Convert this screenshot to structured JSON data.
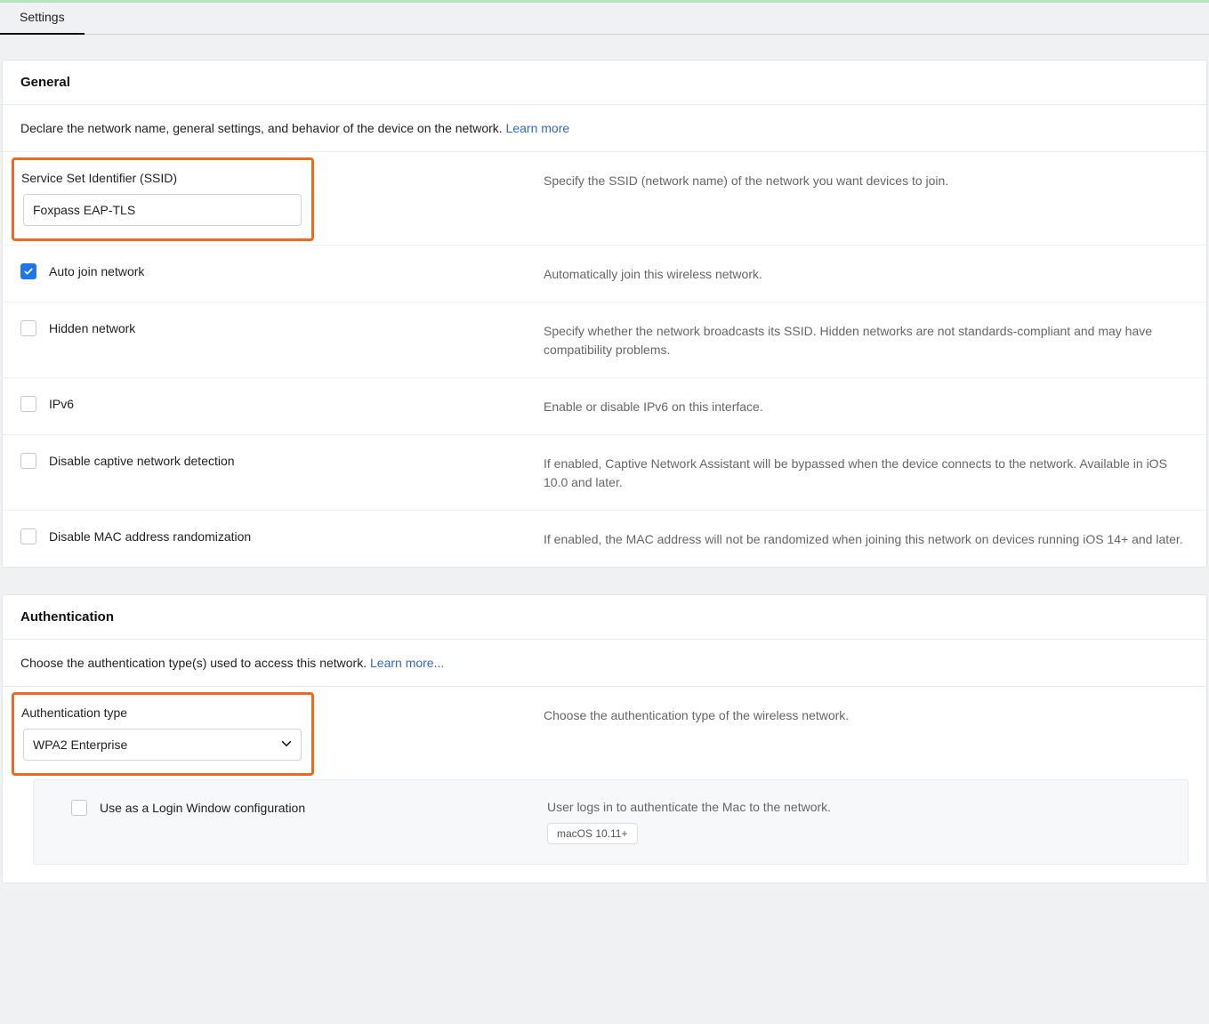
{
  "tab": {
    "label": "Settings"
  },
  "general": {
    "title": "General",
    "intro": "Declare the network name, general settings, and behavior of the device on the network. ",
    "learn": "Learn more",
    "ssid": {
      "label": "Service Set Identifier (SSID)",
      "value": "Foxpass EAP-TLS",
      "desc": "Specify the SSID (network name) of the network you want devices to join."
    },
    "auto_join": {
      "label": "Auto join network",
      "checked": true,
      "desc": "Automatically join this wireless network."
    },
    "hidden": {
      "label": "Hidden network",
      "checked": false,
      "desc": "Specify whether the network broadcasts its SSID. Hidden networks are not standards-compliant and may have compatibility problems."
    },
    "ipv6": {
      "label": "IPv6",
      "checked": false,
      "desc": "Enable or disable IPv6 on this interface."
    },
    "captive": {
      "label": "Disable captive network detection",
      "checked": false,
      "desc": "If enabled, Captive Network Assistant will be bypassed when the device connects to the network. Available in iOS 10.0 and later."
    },
    "mac_random": {
      "label": "Disable MAC address randomization",
      "checked": false,
      "desc": "If enabled, the MAC address will not be randomized when joining this network on devices running iOS 14+ and later."
    }
  },
  "auth": {
    "title": "Authentication",
    "intro": "Choose the authentication type(s) used to access this network. ",
    "learn": "Learn more...",
    "type": {
      "label": "Authentication type",
      "value": "WPA2 Enterprise",
      "desc": "Choose the authentication type of the wireless network."
    },
    "login_window": {
      "label": "Use as a Login Window configuration",
      "checked": false,
      "desc": "User logs in to authenticate the Mac to the network.",
      "badge": "macOS 10.11+"
    }
  }
}
